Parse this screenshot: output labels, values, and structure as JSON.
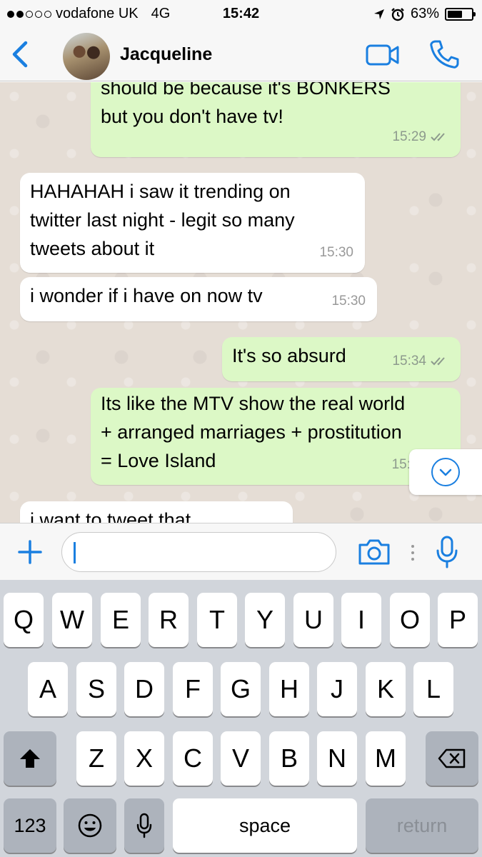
{
  "status_bar": {
    "carrier": "vodafone UK",
    "network": "4G",
    "time": "15:42",
    "battery_percent": "63%",
    "battery_level": 0.63,
    "signal_bars_filled": 2,
    "signal_bars_total": 5
  },
  "header": {
    "contact_name": "Jacqueline"
  },
  "messages": [
    {
      "direction": "out",
      "text": "should be because it's BONKERS\nbut you don't have tv!",
      "time": "15:29"
    },
    {
      "direction": "in",
      "text": "HAHAHAH i saw it trending on\ntwitter last night - legit so many\ntweets about it",
      "time": "15:30"
    },
    {
      "direction": "in",
      "text": "i wonder if i have on now tv",
      "time": "15:30"
    },
    {
      "direction": "out",
      "text": "It's so absurd",
      "time": "15:34"
    },
    {
      "direction": "out",
      "text": "Its like the MTV show the real world\n+ arranged marriages + prostitution\n= Love Island",
      "time": "15:"
    },
    {
      "direction": "in",
      "text": "i want to tweet that",
      "time": ""
    }
  ],
  "input": {
    "value": ""
  },
  "keyboard": {
    "row1": [
      "Q",
      "W",
      "E",
      "R",
      "T",
      "Y",
      "U",
      "I",
      "O",
      "P"
    ],
    "row2": [
      "A",
      "S",
      "D",
      "F",
      "G",
      "H",
      "J",
      "K",
      "L"
    ],
    "row3": [
      "Z",
      "X",
      "C",
      "V",
      "B",
      "N",
      "M"
    ],
    "numbers_label": "123",
    "space_label": "space",
    "return_label": "return"
  },
  "colors": {
    "accent": "#1a7fe0",
    "outgoing_bubble": "#dcf8c6",
    "incoming_bubble": "#ffffff",
    "chat_background": "#e5ddd5"
  },
  "icons": {
    "back": "chevron-left-icon",
    "video": "video-camera-icon",
    "call": "phone-icon",
    "plus": "plus-icon",
    "camera": "camera-icon",
    "mic": "microphone-icon",
    "scroll_down": "chevron-down-icon"
  }
}
